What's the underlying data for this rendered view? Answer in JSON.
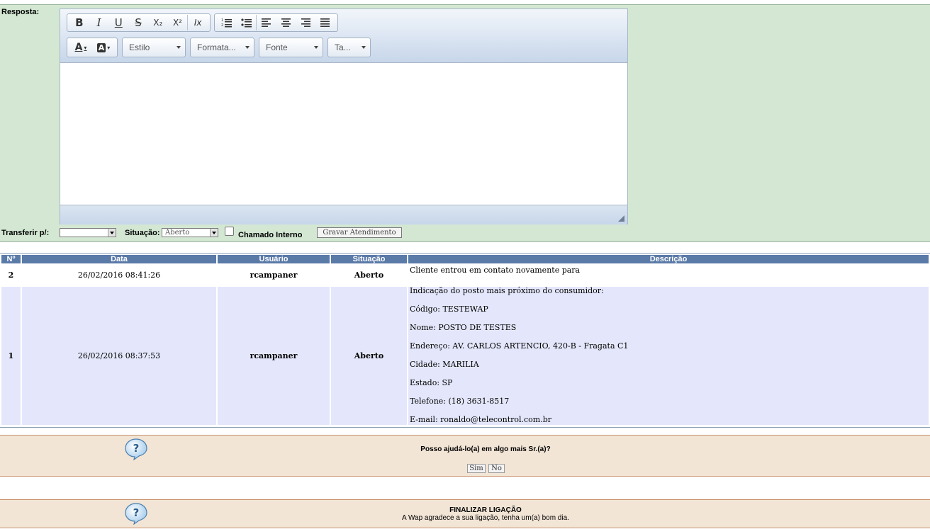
{
  "reply": {
    "label": "Resposta:",
    "toolbar": {
      "bold": "B",
      "italic": "I",
      "underline": "U",
      "strike": "S",
      "subscript": "X₂",
      "superscript": "X²",
      "remove_format": "Ix",
      "font_color": "A",
      "bg_color": "A",
      "style_combo": "Estilo",
      "format_combo": "Formata...",
      "font_combo": "Fonte",
      "size_combo": "Ta..."
    },
    "body_text": ""
  },
  "controls": {
    "transfer_label": "Transferir p/:",
    "transfer_value": "",
    "status_label": "Situação:",
    "status_value": "Aberto",
    "internal_label": "Chamado Interno",
    "save_button": "Gravar Atendimento"
  },
  "history": {
    "headers": [
      "Nº",
      "Data",
      "Usuário",
      "Situação",
      "Descrição"
    ],
    "rows": [
      {
        "num": "2",
        "date": "26/02/2016 08:41:26",
        "user": "rcampaner",
        "status": "Aberto",
        "desc": [
          "Cliente entrou em contato novamente para"
        ]
      },
      {
        "num": "1",
        "date": "26/02/2016 08:37:53",
        "user": "rcampaner",
        "status": "Aberto",
        "desc": [
          "Indicação do posto mais próximo do consumidor:",
          "Código: TESTEWAP",
          "Nome: POSTO DE TESTES",
          "Endereço: AV. CARLOS ARTENCIO, 420-B - Fragata C1",
          "Cidade: MARILIA",
          "Estado: SP",
          "Telefone: (18) 3631-8517",
          "E-mail: ronaldo@telecontrol.com.br"
        ]
      }
    ]
  },
  "help_prompt": {
    "question": "Posso ajudá-lo(a) em algo mais Sr.(a)?",
    "yes": "Sim",
    "no": "No",
    "icon": "question-bubble-icon"
  },
  "finish": {
    "title": "FINALIZAR LIGAÇÃO",
    "message": "A Wap agradece a sua ligação, tenha um(a) bom dia.",
    "icon": "question-bubble-icon"
  }
}
